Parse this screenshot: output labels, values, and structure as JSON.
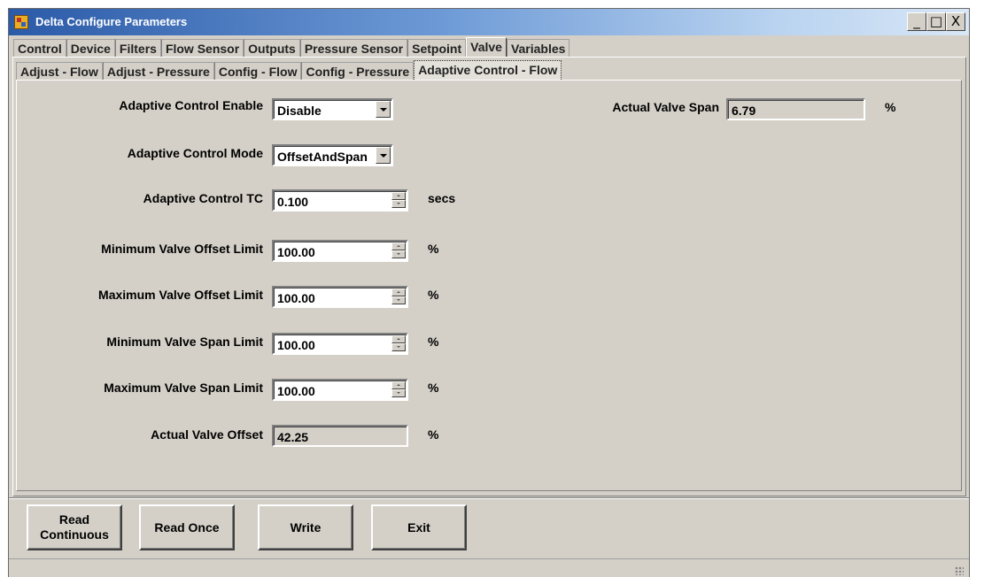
{
  "window": {
    "title": "Delta Configure Parameters",
    "controls": {
      "minimize": "_",
      "maximize": "□",
      "close": "X"
    }
  },
  "tabs_main": [
    "Control",
    "Device",
    "Filters",
    "Flow Sensor",
    "Outputs",
    "Pressure Sensor",
    "Setpoint",
    "Valve",
    "Variables"
  ],
  "tabs_main_active": "Valve",
  "tabs_sub": [
    "Adjust - Flow",
    "Adjust - Pressure",
    "Config - Flow",
    "Config - Pressure",
    "Adaptive Control - Flow"
  ],
  "tabs_sub_active": "Adaptive Control - Flow",
  "form": {
    "adaptive_enable": {
      "label": "Adaptive Control Enable",
      "value": "Disable"
    },
    "adaptive_mode": {
      "label": "Adaptive Control Mode",
      "value": "OffsetAndSpan"
    },
    "adaptive_tc": {
      "label": "Adaptive Control TC",
      "value": "0.100",
      "unit": "secs"
    },
    "min_offset": {
      "label": "Minimum Valve Offset Limit",
      "value": "100.00",
      "unit": "%"
    },
    "max_offset": {
      "label": "Maximum Valve Offset Limit",
      "value": "100.00",
      "unit": "%"
    },
    "min_span": {
      "label": "Minimum Valve Span Limit",
      "value": "100.00",
      "unit": "%"
    },
    "max_span": {
      "label": "Maximum Valve Span Limit",
      "value": "100.00",
      "unit": "%"
    },
    "actual_offset": {
      "label": "Actual Valve Offset",
      "value": "42.25",
      "unit": "%"
    },
    "actual_span": {
      "label": "Actual Valve Span",
      "value": "6.79",
      "unit": "%"
    }
  },
  "buttons": {
    "read_continuous_line1": "Read",
    "read_continuous_line2": "Continuous",
    "read_once": "Read Once",
    "write": "Write",
    "exit": "Exit"
  }
}
